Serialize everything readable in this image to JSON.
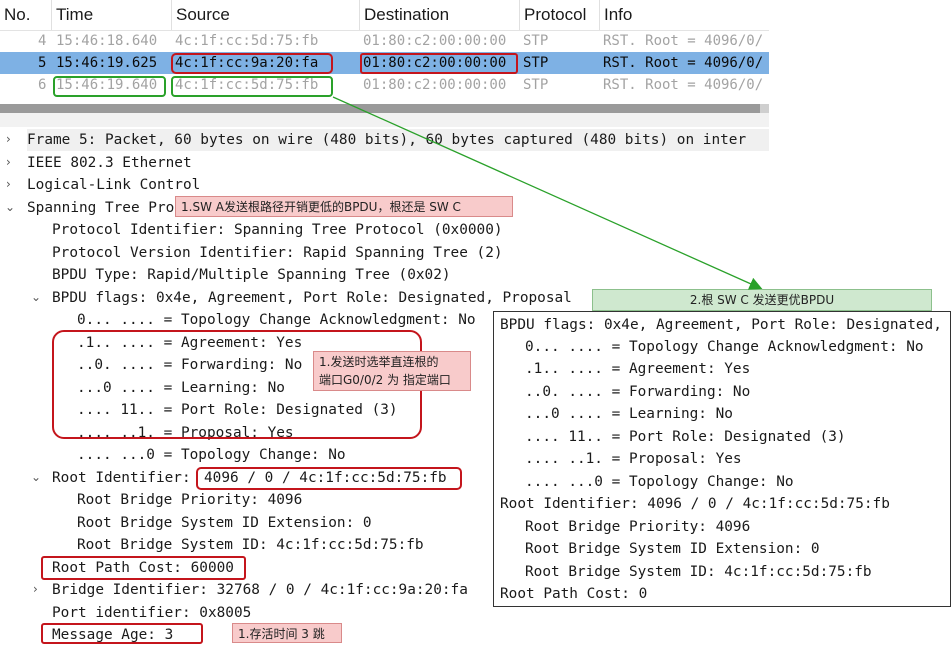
{
  "packet_list": {
    "headers": [
      "No.",
      "Time",
      "Source",
      "Destination",
      "Protocol",
      "Info"
    ],
    "rows": [
      {
        "no": "4",
        "time": "15:46:18.640",
        "source": "4c:1f:cc:5d:75:fb",
        "destination": "01:80:c2:00:00:00",
        "protocol": "STP",
        "info": "RST. Root = 4096/0/"
      },
      {
        "no": "5",
        "time": "15:46:19.625",
        "source": "4c:1f:cc:9a:20:fa",
        "destination": "01:80:c2:00:00:00",
        "protocol": "STP",
        "info": "RST. Root = 4096/0/"
      },
      {
        "no": "6",
        "time": "15:46:19.640",
        "source": "4c:1f:cc:5d:75:fb",
        "destination": "01:80:c2:00:00:00",
        "protocol": "STP",
        "info": "RST. Root = 4096/0/"
      }
    ]
  },
  "details": {
    "frame": "Frame 5: Packet, 60 bytes on wire (480 bits), 60 bytes captured (480 bits) on inter",
    "ieee": "IEEE 802.3 Ethernet",
    "llc": "Logical-Link Control",
    "stp": "Spanning Tree Pro",
    "proto_id": "Protocol Identifier: Spanning Tree Protocol (0x0000)",
    "proto_ver": "Protocol Version Identifier: Rapid Spanning Tree (2)",
    "bpdu_type": "BPDU Type: Rapid/Multiple Spanning Tree (0x02)",
    "bpdu_flags": "BPDU flags: 0x4e, Agreement, Port Role: Designated, Proposal",
    "flag_tc_ack": "0... .... = Topology Change Acknowledgment: No",
    "flag_agreement": ".1.. .... = Agreement: Yes",
    "flag_forwarding": "..0. .... = Forwarding: No",
    "flag_learning": "...0 .... = Learning: No",
    "flag_role": ".... 11.. = Port Role: Designated (3)",
    "flag_proposal": ".... ..1. = Proposal: Yes",
    "flag_tc": ".... ...0 = Topology Change: No",
    "root_id_label": "Root Identifier:",
    "root_id_value": "4096 / 0 / 4c:1f:cc:5d:75:fb",
    "root_priority": "Root Bridge Priority: 4096",
    "root_ext": "Root Bridge System ID Extension: 0",
    "root_sysid": "Root Bridge System ID: 4c:1f:cc:5d:75:fb",
    "root_path_cost": "Root Path Cost: 60000",
    "bridge_id": "Bridge Identifier: 32768 / 0 / 4c:1f:cc:9a:20:fa",
    "port_id": "Port identifier: 0x8005",
    "msg_age": "Message Age: 3"
  },
  "annotations": {
    "note1": "1.SW A发送根路径开销更低的BPDU，根还是 SW C",
    "note2": "1.发送时选举直连根的\n端口G0/0/2 为 指定端口",
    "note3": "1.存活时间 3 跳",
    "note4": "2.根 SW C 发送更优BPDU"
  },
  "compare_panel": {
    "lines": [
      "BPDU flags: 0x4e, Agreement, Port Role: Designated,",
      "0... .... = Topology Change Acknowledgment: No",
      ".1.. .... = Agreement: Yes",
      "..0. .... = Forwarding: No",
      "...0 .... = Learning: No",
      ".... 11.. = Port Role: Designated (3)",
      ".... ..1. = Proposal: Yes",
      ".... ...0 = Topology Change: No",
      "Root Identifier: 4096 / 0 / 4c:1f:cc:5d:75:fb",
      "Root Bridge Priority: 4096",
      "Root Bridge System ID Extension: 0",
      "Root Bridge System ID: 4c:1f:cc:5d:75:fb",
      "Root Path Cost: 0"
    ]
  },
  "colors": {
    "selected_row": "#7eb1e4",
    "red_highlight": "#c4151c",
    "green_highlight": "#2aa12a",
    "red_note_bg": "#f8cbcb",
    "green_note_bg": "#cfe8cf"
  }
}
